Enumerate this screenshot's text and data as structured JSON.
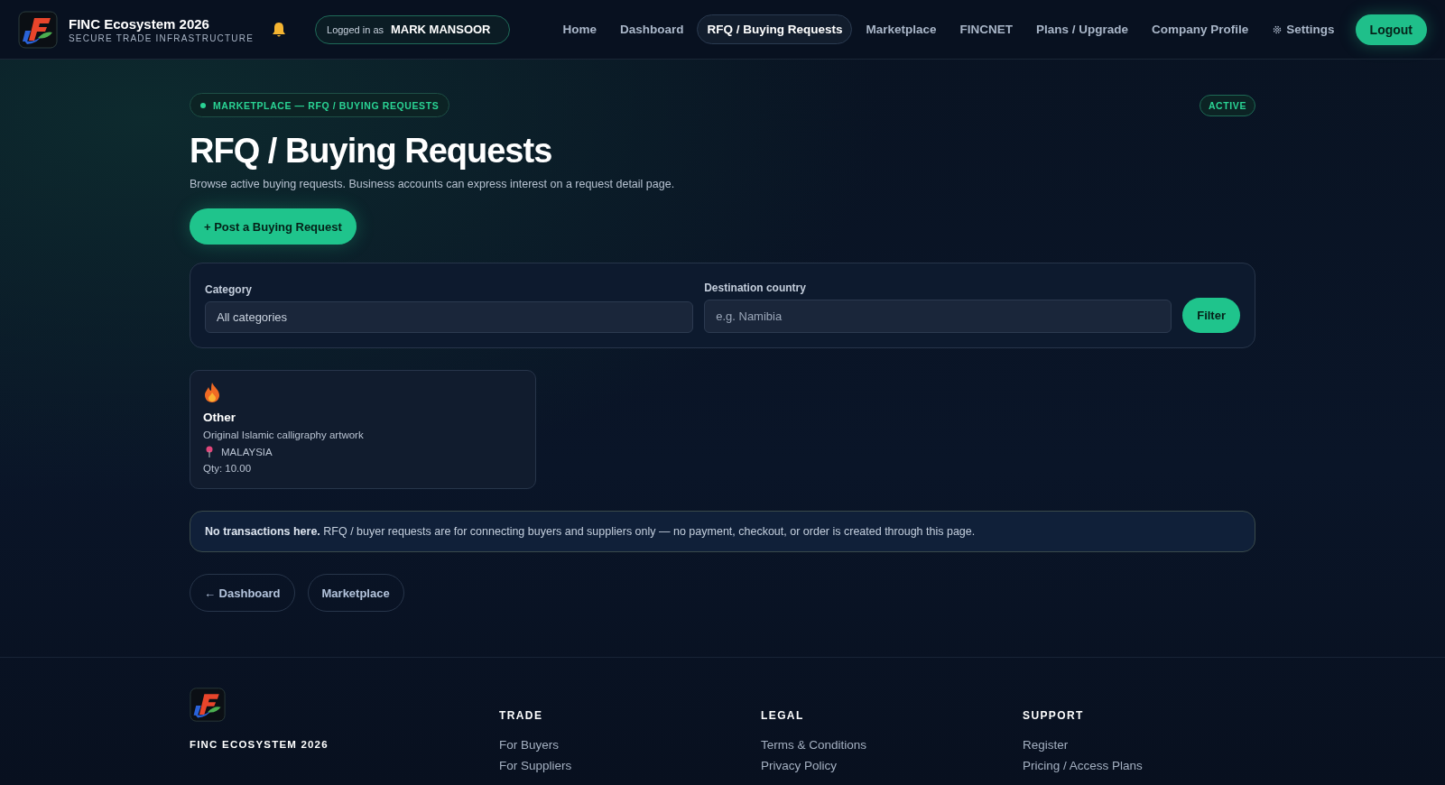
{
  "brand": {
    "title": "FINC Ecosystem 2026",
    "subtitle": "SECURE TRADE INFRASTRUCTURE"
  },
  "user": {
    "prefix": "Logged in as",
    "name": "MARK MANSOOR"
  },
  "nav": [
    {
      "label": "Home",
      "selected": false,
      "kind": "link"
    },
    {
      "label": "Dashboard",
      "selected": false,
      "kind": "link"
    },
    {
      "label": "RFQ / Buying Requests",
      "selected": true,
      "kind": "link"
    },
    {
      "label": "Marketplace",
      "selected": false,
      "kind": "link"
    },
    {
      "label": "FINCNET",
      "selected": false,
      "kind": "link"
    },
    {
      "label": "Plans / Upgrade",
      "selected": false,
      "kind": "link"
    },
    {
      "label": "Company Profile",
      "selected": false,
      "kind": "link"
    },
    {
      "label": "Settings",
      "selected": false,
      "kind": "settings"
    }
  ],
  "logout": "Logout",
  "breadcrumb": "MARKETPLACE — RFQ / BUYING REQUESTS",
  "status": "ACTIVE",
  "title": "RFQ / Buying Requests",
  "subtitle": "Browse active buying requests. Business accounts can express interest on a request detail page.",
  "post_button": "+ Post a Buying Request",
  "filters": {
    "category": {
      "label": "Category",
      "value": "All categories"
    },
    "destination": {
      "label": "Destination country",
      "placeholder": "e.g. Namibia"
    },
    "button": "Filter"
  },
  "requests": [
    {
      "category": "Other",
      "description": "Original Islamic calligraphy artwork",
      "country": "MALAYSIA",
      "quantity": "Qty: 10.00"
    }
  ],
  "notice": "**No transactions here.** RFQ / buyer requests are for connecting buyers and suppliers only — no payment, checkout, or order is created through this page.",
  "links": [
    "← Dashboard",
    "Marketplace"
  ],
  "footer": {
    "brand": "FINC ECOSYSTEM 2026",
    "columns": [
      {
        "heading": "TRADE",
        "links": [
          "For Buyers",
          "For Suppliers"
        ]
      },
      {
        "heading": "LEGAL",
        "links": [
          "Terms & Conditions",
          "Privacy Policy"
        ]
      },
      {
        "heading": "SUPPORT",
        "links": [
          "Register",
          "Pricing / Access Plans"
        ]
      }
    ]
  }
}
